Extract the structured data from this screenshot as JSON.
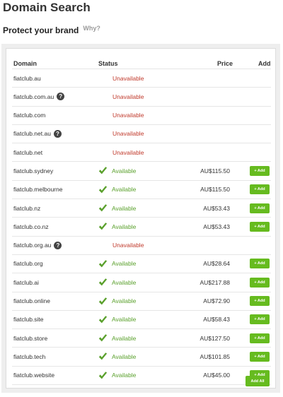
{
  "page": {
    "title": "Domain Search",
    "subtitle": "Protect your brand",
    "why_link": "Why?"
  },
  "table": {
    "headers": {
      "domain": "Domain",
      "status": "Status",
      "price": "Price",
      "add": "Add"
    },
    "available_label": "Available",
    "unavailable_label": "Unavailable",
    "add_button_label": "+ Add",
    "add_all_label": "Add All",
    "colors": {
      "available": "#5aa02c",
      "unavailable": "#c0392b",
      "button": "#66bb1f"
    },
    "rows": [
      {
        "domain": "fiatclub.au",
        "status": "Unavailable",
        "price": "",
        "help": false
      },
      {
        "domain": "fiatclub.com.au",
        "status": "Unavailable",
        "price": "",
        "help": true
      },
      {
        "domain": "fiatclub.com",
        "status": "Unavailable",
        "price": "",
        "help": false
      },
      {
        "domain": "fiatclub.net.au",
        "status": "Unavailable",
        "price": "",
        "help": true
      },
      {
        "domain": "fiatclub.net",
        "status": "Unavailable",
        "price": "",
        "help": false
      },
      {
        "domain": "fiatclub.sydney",
        "status": "Available",
        "price": "AU$115.50",
        "help": false
      },
      {
        "domain": "fiatclub.melbourne",
        "status": "Available",
        "price": "AU$115.50",
        "help": false
      },
      {
        "domain": "fiatclub.nz",
        "status": "Available",
        "price": "AU$53.43",
        "help": false
      },
      {
        "domain": "fiatclub.co.nz",
        "status": "Available",
        "price": "AU$53.43",
        "help": false
      },
      {
        "domain": "fiatclub.org.au",
        "status": "Unavailable",
        "price": "",
        "help": true
      },
      {
        "domain": "fiatclub.org",
        "status": "Available",
        "price": "AU$28.64",
        "help": false
      },
      {
        "domain": "fiatclub.ai",
        "status": "Available",
        "price": "AU$217.88",
        "help": false
      },
      {
        "domain": "fiatclub.online",
        "status": "Available",
        "price": "AU$72.90",
        "help": false
      },
      {
        "domain": "fiatclub.site",
        "status": "Available",
        "price": "AU$58.43",
        "help": false
      },
      {
        "domain": "fiatclub.store",
        "status": "Available",
        "price": "AU$127.50",
        "help": false
      },
      {
        "domain": "fiatclub.tech",
        "status": "Available",
        "price": "AU$101.85",
        "help": false
      },
      {
        "domain": "fiatclub.website",
        "status": "Available",
        "price": "AU$45.00",
        "help": false
      }
    ]
  }
}
